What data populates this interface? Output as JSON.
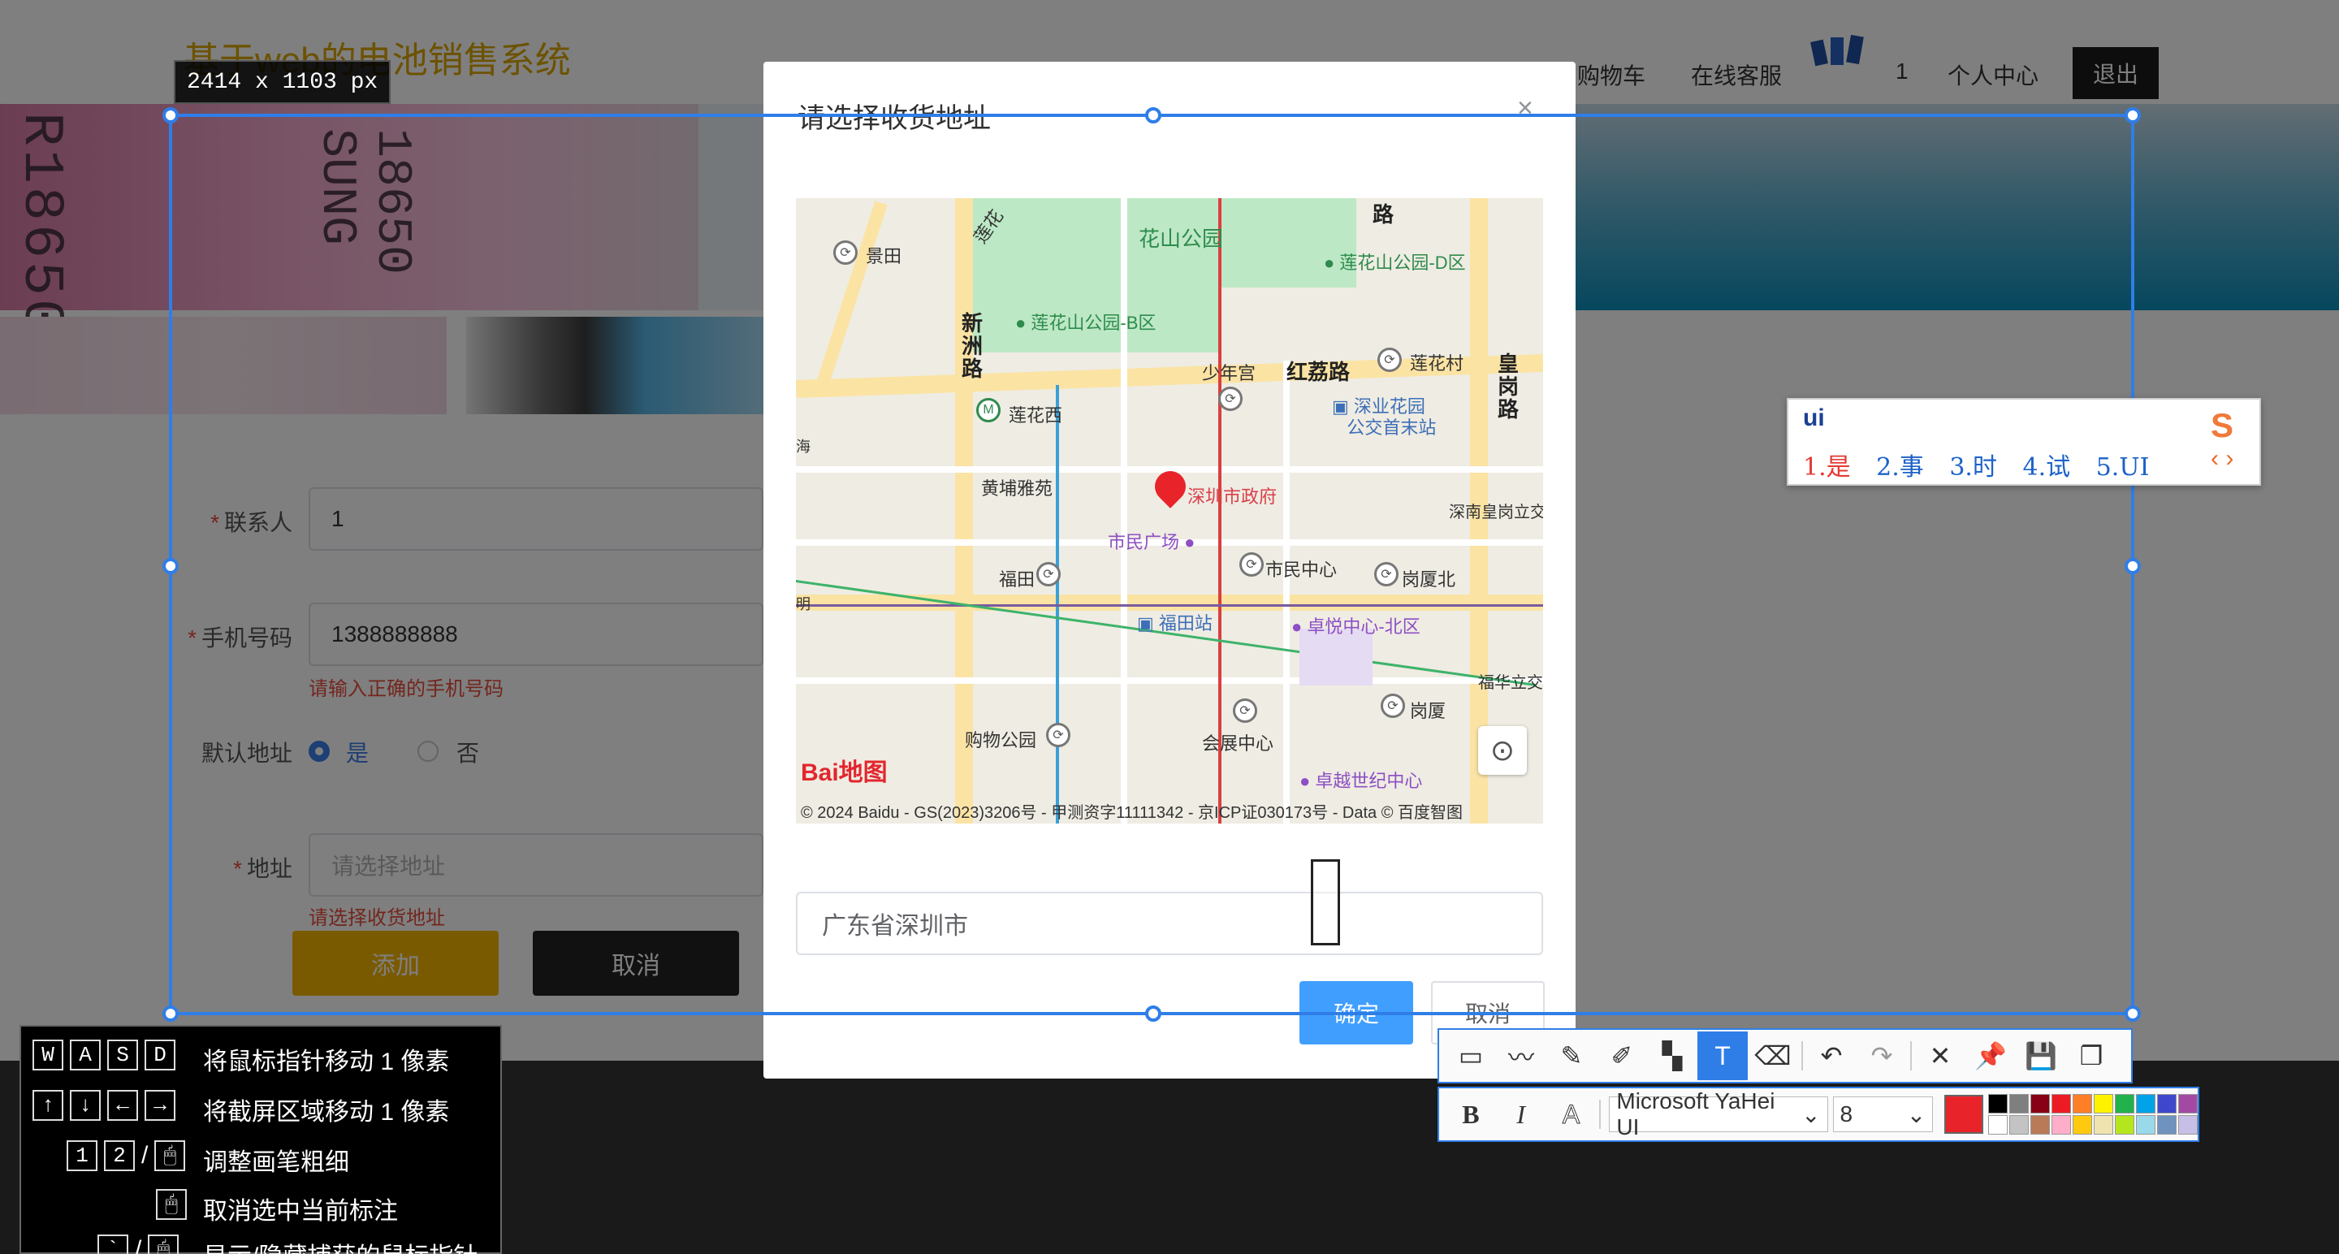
{
  "header": {
    "site_title": "基于web的电池销售系统",
    "nav": [
      "购物车",
      "在线客服"
    ],
    "cart_count": "1",
    "user_center": "个人中心",
    "logout": "退出"
  },
  "banner": {
    "print_text_left": "R18650",
    "print_text_right": "18650 SUNG"
  },
  "form": {
    "contact_label": "联系人",
    "contact_value": "1",
    "phone_label": "手机号码",
    "phone_value": "1388888888",
    "phone_error": "请输入正确的手机号码",
    "default_label": "默认地址",
    "default_yes": "是",
    "default_no": "否",
    "address_label": "地址",
    "address_placeholder": "请选择地址",
    "address_error": "请选择收货地址",
    "add_button": "添加",
    "cancel_button": "取消",
    "required_mark": "*"
  },
  "modal": {
    "title": "请选择收货地址",
    "close": "×",
    "address_value": "广东省深圳市",
    "confirm": "确定",
    "cancel": "取消"
  },
  "map": {
    "labels": {
      "jingtian": "景田",
      "lianhuashan_park": "花山公园",
      "lianhua_d": "莲花山公园-D区",
      "lianhua_b": "莲花山公园-B区",
      "xinzhou_road": "新洲路",
      "shaoniangong": "少年宫",
      "honglilu": "红荔路",
      "lianhuacun": "莲花村",
      "huanggang_road": "皇岗路",
      "lianhuaxi": "莲花西",
      "shenye_park": "深业花园",
      "bus_terminal": "公交首末站",
      "huangpuyayuan": "黄埔雅苑",
      "shenzhen_gov": "深圳市政府",
      "shenan_huanggang": "深南皇岗立交",
      "shimin_square": "市民广场",
      "futian": "福田",
      "shimin_center": "市民中心",
      "gangxia_north": "岗厦北",
      "futian_station": "福田站",
      "zhuoyue_north": "卓悦中心-北区",
      "fuhua_bridge": "福华立交",
      "gangxia": "岗厦",
      "shopping_park": "购物公园",
      "convention_center": "会展中心",
      "zhuoyue_century": "卓越世纪中心",
      "lu": "路",
      "lianhua": "莲花",
      "hai": "海",
      "ming": "明"
    },
    "logo": "Bai地图",
    "copyright": "© 2024 Baidu - GS(2023)3206号 - 甲测资字11111342 - 京ICP证030173号 - Data © 百度智图"
  },
  "capture": {
    "size_readout": "2414 x 1103  px"
  },
  "ime": {
    "input": "ui",
    "candidates": [
      "1.是",
      "2.事",
      "3.时",
      "4.试",
      "5.UI"
    ],
    "nav": "‹ ›",
    "logo": "S"
  },
  "help": {
    "rows": [
      {
        "keys": [
          "W",
          "A",
          "S",
          "D"
        ],
        "text": "将鼠标指针移动 1 像素"
      },
      {
        "keys": [
          "↑",
          "↓",
          "←",
          "→"
        ],
        "text": "将截屏区域移动 1 像素"
      },
      {
        "keys": [
          "1",
          "2",
          "/",
          "🖱"
        ],
        "text": "调整画笔粗细"
      },
      {
        "keys": [
          "🖱"
        ],
        "text": "取消选中当前标注"
      },
      {
        "keys": [
          "`",
          "/",
          "🖱"
        ],
        "text": "显示/隐藏捕获的鼠标指针"
      }
    ]
  },
  "toolbar": {
    "tools": [
      "rectangle",
      "polyline",
      "pen",
      "marker",
      "mosaic",
      "text",
      "eraser",
      "undo",
      "redo",
      "close",
      "pin",
      "save",
      "copy"
    ],
    "active": "text"
  },
  "textbar": {
    "bold": "B",
    "italic": "I",
    "outline": "A",
    "font": "Microsoft YaHei UI",
    "size": "8",
    "current_color": "#e8242a",
    "palette": [
      "#000000",
      "#7f7f7f",
      "#880015",
      "#ed1c24",
      "#ff7f27",
      "#fff200",
      "#22b14c",
      "#00a2e8",
      "#3f48cc",
      "#a349a4",
      "#ffffff",
      "#c3c3c3",
      "#b97a57",
      "#ffaec9",
      "#ffc90e",
      "#efe4b0",
      "#b5e61d",
      "#99d9ea",
      "#7092be",
      "#c8bfe7"
    ]
  }
}
